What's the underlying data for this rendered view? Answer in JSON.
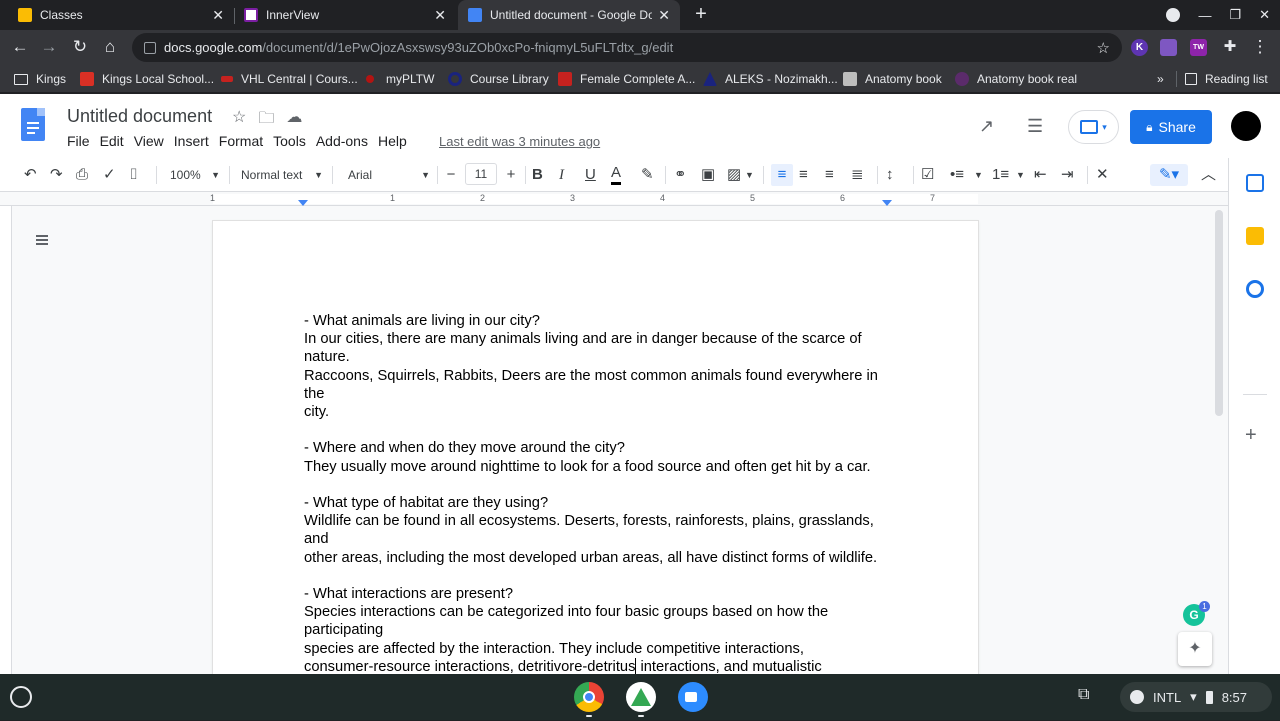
{
  "browser": {
    "tabs": [
      {
        "label": "Classes",
        "icon_color": "#fbbc04",
        "active": false
      },
      {
        "label": "InnerView",
        "icon_color": "#ffffff",
        "active": false
      },
      {
        "label": "Untitled document - Google Docs",
        "icon_color": "#4285f4",
        "active": true
      }
    ],
    "new_tab_label": "+",
    "url_host": "docs.google.com",
    "url_path": "/document/d/1ePwOjozAsxswsy93uZOb0xcPo-fniqmyL5uFLTdtx_g/edit",
    "extensions": [
      {
        "label": "K",
        "color": "#5e35b1"
      },
      {
        "label": "",
        "color": "#7e57c2"
      },
      {
        "label": "TW",
        "color": "#8e24aa"
      }
    ]
  },
  "bookmarks": [
    {
      "label": "Kings",
      "icon": "folder-icon",
      "color": "#e8eaed"
    },
    {
      "label": "Kings Local School...",
      "icon": "school-icon",
      "color": "#d93025"
    },
    {
      "label": "VHL Central | Cours...",
      "icon": "vhl-icon",
      "color": "#c5221f"
    },
    {
      "label": "myPLTW",
      "icon": "pltw-icon",
      "color": "#b31412"
    },
    {
      "label": "Course Library",
      "icon": "course-icon",
      "color": "#1a237e"
    },
    {
      "label": "Female Complete A...",
      "icon": "female-icon",
      "color": "#c5221f"
    },
    {
      "label": "ALEKS - Nozimakh...",
      "icon": "aleks-icon",
      "color": "#1a237e"
    },
    {
      "label": "Anatomy book",
      "icon": "book-icon",
      "color": "#bdbdbd"
    },
    {
      "label": "Anatomy book real",
      "icon": "pearson-icon",
      "color": "#5b2b6b"
    }
  ],
  "bookmarks_overflow": "»",
  "reading_list_label": "Reading list",
  "docs": {
    "title": "Untitled document",
    "menu": [
      "File",
      "Edit",
      "View",
      "Insert",
      "Format",
      "Tools",
      "Add-ons",
      "Help"
    ],
    "last_edit": "Last edit was 3 minutes ago",
    "share_label": "Share",
    "toolbar": {
      "zoom": "100%",
      "style": "Normal text",
      "font": "Arial",
      "font_size": "11"
    },
    "ruler_numbers": [
      "1",
      "1",
      "2",
      "3",
      "4",
      "5",
      "6",
      "7"
    ],
    "body": [
      "- What animals are living in our city?",
      "In our cities, there are many animals living and are in danger because of the scarce of nature.",
      "Raccoons, Squirrels, Rabbits, Deers are the most common animals found everywhere in the",
      "city.",
      "",
      "- Where and when do they move around the city?",
      "They usually move around nighttime to look for a food source and often get hit by a car.",
      "",
      "- What type of habitat are they using?",
      "Wildlife can be found in all ecosystems. Deserts, forests, rainforests, plains, grasslands, and",
      "other areas, including the most developed urban areas, all have distinct forms of wildlife.",
      "",
      "- What interactions are present?",
      "Species interactions can be categorized into four basic groups based on how the participating",
      "species are affected by the interaction. They include competitive interactions,"
    ],
    "last_line_before_cursor": "consumer-resource interactions, detritivore-detritus",
    "last_line_after_cursor": " interactions, and mutualistic interactions.",
    "grammarly_count": "1"
  },
  "shelf": {
    "ime": "INTL",
    "time": "8:57"
  }
}
